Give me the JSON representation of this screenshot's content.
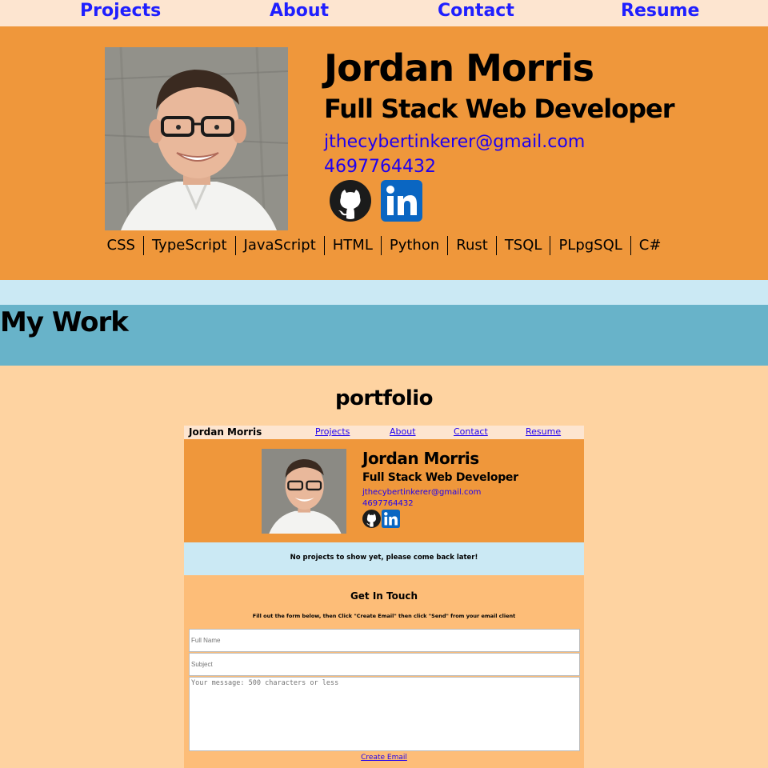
{
  "nav": {
    "projects": "Projects",
    "about": "About",
    "contact": "Contact",
    "resume": "Resume"
  },
  "header": {
    "name": "Jordan Morris",
    "role": "Full Stack Web Developer",
    "email": "jthecybertinkerer@gmail.com",
    "phone": "4697764432",
    "icons": [
      "github-icon",
      "linkedin-icon"
    ]
  },
  "skills": [
    "CSS",
    "TypeScript",
    "JavaScript",
    "HTML",
    "Python",
    "Rust",
    "TSQL",
    "PLpgSQL",
    "C#"
  ],
  "work": {
    "title": "My Work"
  },
  "portfolio": {
    "title": "portfolio",
    "preview": {
      "brand": "Jordan Morris",
      "nav": {
        "projects": "Projects",
        "about": "About",
        "contact": "Contact",
        "resume": "Resume"
      },
      "name": "Jordan Morris",
      "role": "Full Stack Web Developer",
      "email": "jthecybertinkerer@gmail.com",
      "phone": "4697764432",
      "no_projects": "No projects to show yet, please come back later!",
      "get_in_touch": "Get In Touch",
      "instructions": "Fill out the form below, then Click \"Create Email\" then click \"Send\" from your email client",
      "full_name_placeholder": "Full Name",
      "subject_placeholder": "Subject",
      "message_placeholder": "Your message: 500 characters or less",
      "create_email": "Create Email"
    }
  },
  "colors": {
    "nav_bg": "#fde5d0",
    "hero_bg": "#ef973b",
    "strip_bg": "#cbe9f4",
    "work_bg": "#68b3c9",
    "page_bg": "#fed3a1",
    "link": "#1f00f0"
  }
}
